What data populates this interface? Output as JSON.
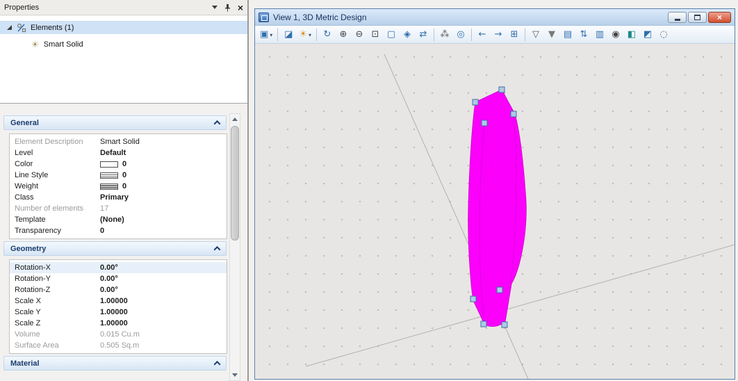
{
  "properties_panel": {
    "title": "Properties",
    "tree": {
      "root_label": "Elements (1)",
      "child_label": "Smart Solid"
    },
    "sections": {
      "general": {
        "title": "General",
        "rows": [
          {
            "label": "Element Description",
            "value": "Smart Solid",
            "label_muted": true
          },
          {
            "label": "Level",
            "value": "Default",
            "value_bold": true
          },
          {
            "label": "Color",
            "value": "0",
            "value_bold": true,
            "swatch": "color"
          },
          {
            "label": "Line Style",
            "value": "0",
            "value_bold": true,
            "swatch": "linestyle"
          },
          {
            "label": "Weight",
            "value": "0",
            "value_bold": true,
            "swatch": "weight"
          },
          {
            "label": "Class",
            "value": "Primary",
            "value_bold": true
          },
          {
            "label": "Number of elements",
            "value": "17",
            "label_muted": true,
            "value_muted": true
          },
          {
            "label": "Template",
            "value": "(None)",
            "value_bold": true
          },
          {
            "label": "Transparency",
            "value": "0",
            "value_bold": true
          }
        ]
      },
      "geometry": {
        "title": "Geometry",
        "rows": [
          {
            "label": "Rotation-X",
            "value": "0.00°",
            "value_bold": true,
            "highlight": true
          },
          {
            "label": "Rotation-Y",
            "value": "0.00°",
            "value_bold": true
          },
          {
            "label": "Rotation-Z",
            "value": "0.00°",
            "value_bold": true
          },
          {
            "label": "Scale X",
            "value": "1.00000",
            "value_bold": true
          },
          {
            "label": "Scale Y",
            "value": "1.00000",
            "value_bold": true
          },
          {
            "label": "Scale Z",
            "value": "1.00000",
            "value_bold": true
          },
          {
            "label": "Volume",
            "value": "0.015 Cu.m",
            "label_muted": true,
            "value_muted": true
          },
          {
            "label": "Surface Area",
            "value": "0.505 Sq.m",
            "label_muted": true,
            "value_muted": true
          }
        ]
      },
      "material": {
        "title": "Material"
      }
    }
  },
  "view_window": {
    "title": "View 1, 3D Metric Design",
    "toolbar": [
      {
        "name": "view-display-mode",
        "glyph": "▣",
        "color": "#2f6fad",
        "dropdown": true
      },
      {
        "type": "sep"
      },
      {
        "name": "view-attributes",
        "glyph": "◪",
        "color": "#2f6fad"
      },
      {
        "name": "adjust-view-brightness",
        "glyph": "☀",
        "color": "#d9912a",
        "dropdown": true
      },
      {
        "type": "sep"
      },
      {
        "name": "update-view",
        "glyph": "↻",
        "color": "#2f6fad"
      },
      {
        "name": "zoom-in",
        "glyph": "⊕",
        "color": "#454545"
      },
      {
        "name": "zoom-out",
        "glyph": "⊖",
        "color": "#454545"
      },
      {
        "name": "window-area",
        "glyph": "⊡",
        "color": "#454545"
      },
      {
        "name": "fit-view",
        "glyph": "▢",
        "color": "#2f6fad"
      },
      {
        "name": "rotate-view",
        "glyph": "◈",
        "color": "#2f6fad"
      },
      {
        "name": "pan-view",
        "glyph": "⇄",
        "color": "#2f6fad"
      },
      {
        "type": "sep"
      },
      {
        "name": "walk",
        "glyph": "⁂",
        "color": "#5a5a5a"
      },
      {
        "name": "navigate-view",
        "glyph": "◎",
        "color": "#2f6fad"
      },
      {
        "type": "sep"
      },
      {
        "name": "view-previous",
        "glyph": "←",
        "color": "#2f6fad"
      },
      {
        "name": "view-next",
        "glyph": "→",
        "color": "#2f6fad"
      },
      {
        "name": "copy-view",
        "glyph": "⊞",
        "color": "#2f6fad"
      },
      {
        "type": "sep"
      },
      {
        "name": "clip-volume",
        "glyph": "▽",
        "color": "#5a5a5a"
      },
      {
        "name": "clip-mask",
        "glyph": "▼",
        "color": "#7a7a7a"
      },
      {
        "name": "level-display",
        "glyph": "▤",
        "color": "#2f6fad"
      },
      {
        "name": "sort-levels",
        "glyph": "⇅",
        "color": "#2f6fad"
      },
      {
        "name": "saved-views",
        "glyph": "▥",
        "color": "#2f6fad"
      },
      {
        "name": "define-camera",
        "glyph": "◉",
        "color": "#454545"
      },
      {
        "name": "render",
        "glyph": "◧",
        "color": "#1b8a8a"
      },
      {
        "name": "view-cube",
        "glyph": "◩",
        "color": "#2f6fad"
      },
      {
        "name": "navigate-rotation",
        "glyph": "◌",
        "color": "#5a5a5a"
      }
    ]
  },
  "colors": {
    "solid_fill": "#fb00fb",
    "solid_edge": "#d600d6",
    "handle_fill": "#aecbe8",
    "handle_border": "#3f6fa0",
    "selection_bg": "#cfe2f6",
    "axis_line": "#b3b1af"
  }
}
